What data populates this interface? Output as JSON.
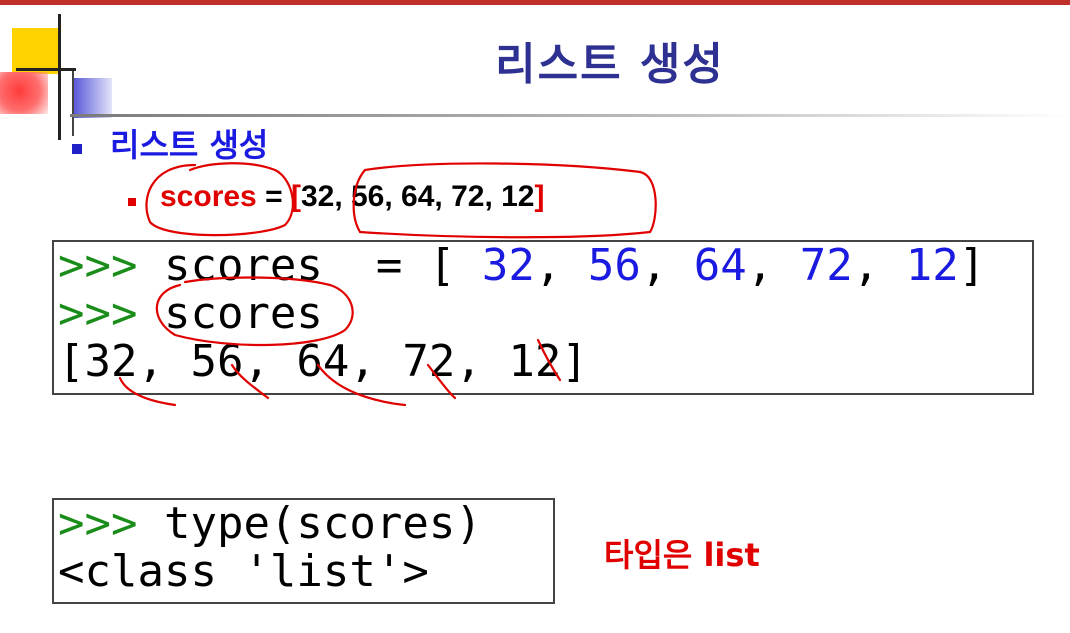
{
  "slide": {
    "title": "리스트 생성",
    "heading": "리스트 생성",
    "assignment": {
      "var": "scores",
      "eq": " = ",
      "open": "[",
      "values": "32, 56, 64, 72, 12",
      "close": "]"
    }
  },
  "code1": {
    "line1": {
      "prompt": ">>>",
      "text1": " scores  = [ ",
      "n1": "32",
      "s1": ", ",
      "n2": "56",
      "s2": ", ",
      "n3": "64",
      "s3": ", ",
      "n4": "72",
      "s4": ", ",
      "n5": "12",
      "end": "]"
    },
    "line2": {
      "prompt": ">>>",
      "text": " scores"
    },
    "line3": {
      "text": "[32, 56, 64, 72, 12]"
    }
  },
  "code2": {
    "line1": {
      "prompt": ">>>",
      "text": " type(scores)"
    },
    "line2": {
      "text": "<class 'list'>"
    }
  },
  "note": "타입은 list",
  "colors": {
    "title": "#2e3192",
    "heading": "#1a1ae0",
    "red": "#e00000",
    "prompt": "#1a8c1a",
    "number": "#1a1ae0"
  }
}
